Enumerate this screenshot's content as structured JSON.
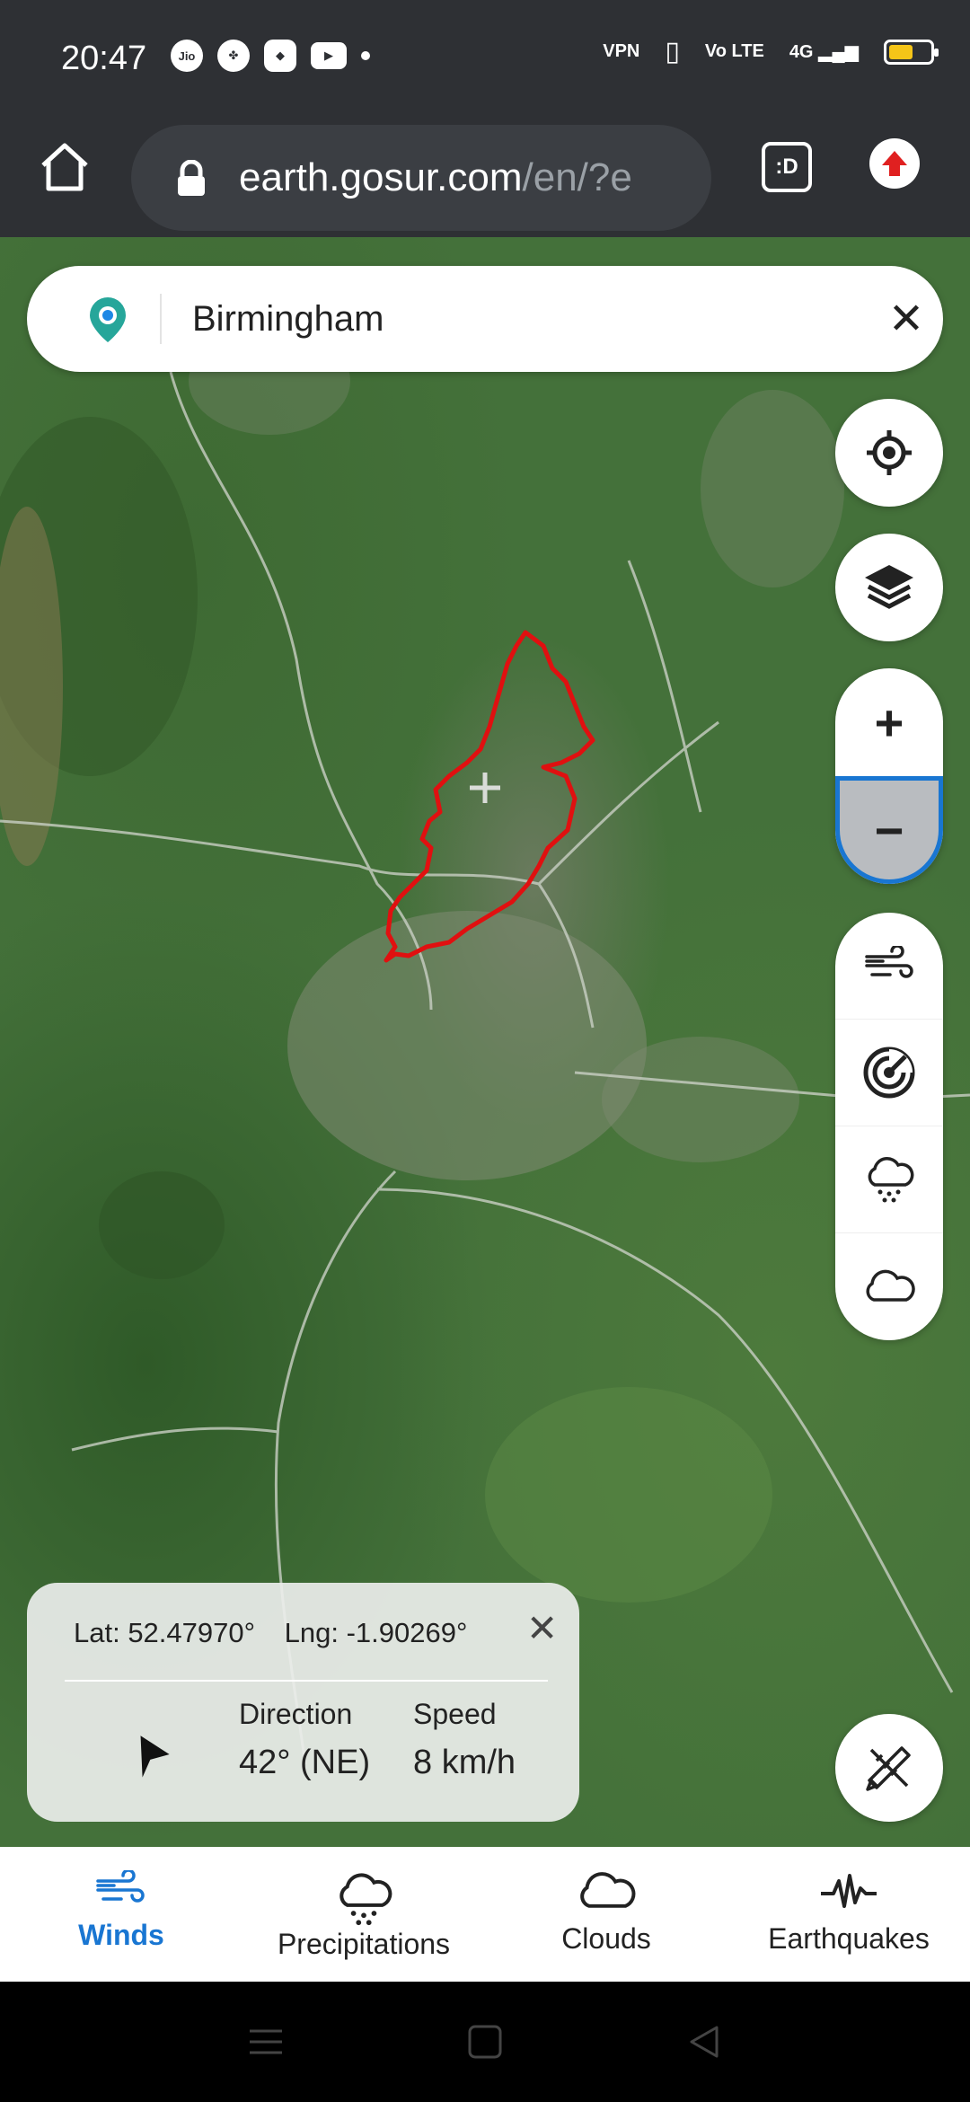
{
  "status_bar": {
    "time": "20:47",
    "left_icons": [
      "jio-icon",
      "fan-icon",
      "gamepad-icon",
      "youtube-icon",
      "dot-icon"
    ],
    "right_icons": [
      "vpn-icon",
      "vibrate-icon",
      "volte-icon",
      "signal-4g-icon",
      "battery-icon"
    ],
    "vpn_label": "VPN",
    "volte_label": "Vo LTE",
    "network_label": "4G",
    "battery_color": "#f5c518"
  },
  "browser": {
    "url_host": "earth.gosur.com",
    "url_path": "/en/?e",
    "tab_label": ":D"
  },
  "search": {
    "value": "Birmingham",
    "clear_label": "✕"
  },
  "controls": {
    "zoom_in": "+",
    "zoom_out": "−"
  },
  "info_card": {
    "lat": "Lat: 52.47970°",
    "lng": "Lng: -1.90269°",
    "direction_label": "Direction",
    "direction_value": "42° (NE)",
    "speed_label": "Speed",
    "speed_value": "8 km/h",
    "close_label": "✕"
  },
  "bottom_nav": {
    "items": [
      {
        "label": "Winds",
        "icon": "wind-icon",
        "active": true
      },
      {
        "label": "Precipitations",
        "icon": "rain-cloud-icon",
        "active": false
      },
      {
        "label": "Clouds",
        "icon": "cloud-icon",
        "active": false
      },
      {
        "label": "Earthquakes",
        "icon": "seismograph-icon",
        "active": false
      }
    ]
  },
  "colors": {
    "accent": "#1976d2",
    "boundary": "#e01010",
    "brand_pin": "#26a69a"
  }
}
